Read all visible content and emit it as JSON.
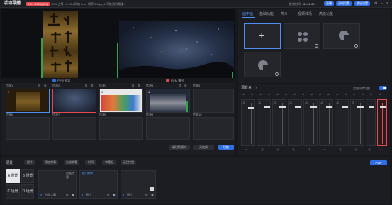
{
  "app": {
    "title": "活动导播",
    "badge": "5.8.1-2009(B87)",
    "stats": "CPU 占用 10.18%",
    "stats2": "网络 0ms",
    "stats3": "帧率 0.0fps_4",
    "stats4": "可推流到频道:1"
  },
  "topbar": {
    "timer_label": "推流时间",
    "timer": "00:00:00",
    "btn_live": "直播",
    "btn_record": "录制设置",
    "btn_output": "输出设置"
  },
  "preview": {
    "pvw_label": "PVW 预监",
    "pgm_label": "PGM 播出"
  },
  "right_tabs": [
    "画中画",
    "基础功能",
    "简介",
    "视频转场",
    "高级功能"
  ],
  "sources": [
    {
      "label": "信源1",
      "num": "1"
    },
    {
      "label": "信源2",
      "num": "2"
    },
    {
      "label": "信源3",
      "num": "3"
    },
    {
      "label": "信源4",
      "num": "4"
    },
    {
      "label": "信源5",
      "num": ""
    },
    {
      "label": "信源6",
      "num": ""
    },
    {
      "label": "信源7",
      "num": ""
    },
    {
      "label": "信源8",
      "num": ""
    },
    {
      "label": "信源9",
      "num": ""
    },
    {
      "label": "信源10",
      "num": ""
    }
  ],
  "source_controls": {
    "transition": "硬切换模式",
    "effect": "无效果",
    "cut": "切换"
  },
  "mixer": {
    "title": "调音台",
    "sync_label": "音频同步切换",
    "scale": [
      "-5",
      "-10",
      "-20",
      "-30",
      "-40",
      "-60"
    ]
  },
  "bottom": {
    "title": "场景",
    "actions": [
      "图片",
      "添加字幕",
      "合成字幕",
      "时间",
      "字幕板",
      "云台控制"
    ],
    "pvw_btn": "PVW",
    "scene_a": "A 场景",
    "scene_b": "B 场景",
    "scene_c": "C 场景",
    "scene_d": "D 场景",
    "item1": "时间字幕",
    "item2": "图片",
    "item3": "图片",
    "tag1": "内嵌字幕",
    "tag2": "图片编辑"
  }
}
